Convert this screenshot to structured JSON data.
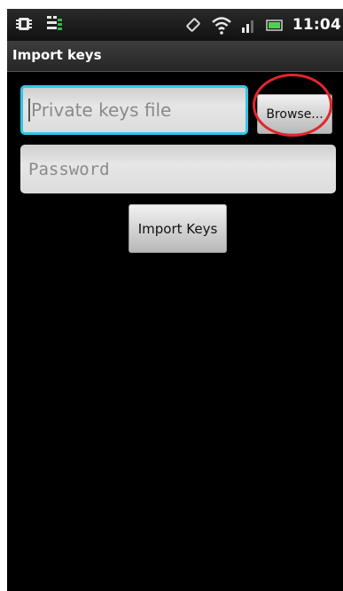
{
  "status_bar": {
    "time": "11:04",
    "icons": [
      "android-debug-icon",
      "notification-list-icon",
      "vibrate-icon",
      "wifi-icon",
      "signal-icon",
      "battery-icon"
    ]
  },
  "title_bar": {
    "title": "Import keys"
  },
  "form": {
    "keys_file": {
      "placeholder": "Private keys file",
      "value": ""
    },
    "browse_label": "Browse...",
    "password": {
      "placeholder": "Password",
      "value": ""
    },
    "import_label": "Import Keys"
  },
  "colors": {
    "background": "#000000",
    "focus_border": "#2fc7e8",
    "highlight_ring": "#e0262b",
    "field_text": "#8a8a8a"
  }
}
